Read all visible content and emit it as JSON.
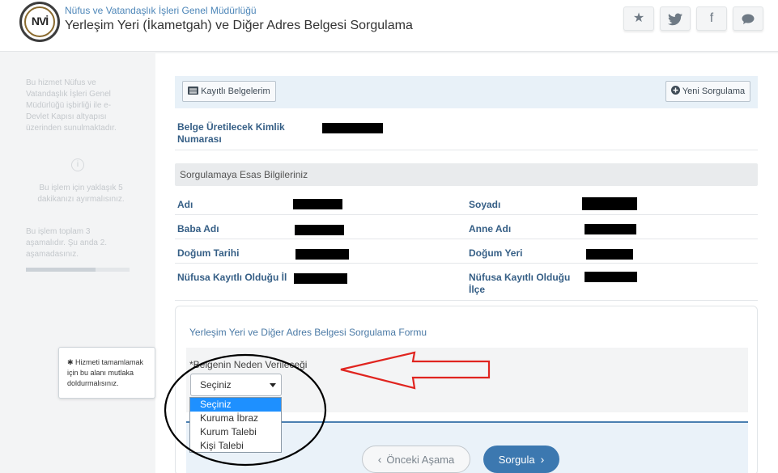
{
  "header": {
    "logo_text": "NVİ",
    "org_title": "Nüfus ve Vatandaşlık İşleri Genel Müdürlüğü",
    "page_title": "Yerleşim Yeri (İkametgah) ve Diğer Adres Belgesi Sorgulama",
    "buttons": [
      {
        "name": "favorite-button",
        "icon": "star-icon",
        "glyph": "★"
      },
      {
        "name": "twitter-button",
        "icon": "twitter-icon",
        "glyph": "🐦"
      },
      {
        "name": "facebook-button",
        "icon": "facebook-icon",
        "glyph": "f"
      },
      {
        "name": "comment-button",
        "icon": "comment-icon",
        "glyph": "💬"
      }
    ]
  },
  "sidebar": {
    "info_text": "Bu hizmet Nüfus ve Vatandaşlık İşleri Genel Müdürlüğü işbirliği ile e-Devlet Kapısı altyapısı üzerinden sunulmaktadır.",
    "duration_text": "Bu işlem için yaklaşık 5 dakikanızı ayırmalısınız.",
    "steps_text": "Bu işlem toplam 3 aşamalıdır. Şu anda 2. aşamadasınız.",
    "progress": 0.67
  },
  "topbar": {
    "saved_docs_label": "Kayıtlı Belgelerim",
    "new_query_label": "Yeni Sorgulama"
  },
  "identity": {
    "label": "Belge Üretilecek Kimlik Numarası"
  },
  "section_title": "Sorgulamaya Esas Bilgileriniz",
  "fields": {
    "ad": "Adı",
    "soyad": "Soyadı",
    "baba_adi": "Baba Adı",
    "anne_adi": "Anne Adı",
    "dogum_tarihi": "Doğum Tarihi",
    "dogum_yeri": "Doğum Yeri",
    "nufus_il": "Nüfusa Kayıtlı Olduğu İl",
    "nufus_ilce": "Nüfusa Kayıtlı Olduğu İlçe"
  },
  "form": {
    "title": "Yerleşim Yeri ve Diğer Adres Belgesi Sorgulama Formu",
    "field_label": "*Belgenin Neden Verileceği",
    "select_value": "Seçiniz",
    "options": [
      "Seçiniz",
      "Kuruma İbraz",
      "Kurum Talebi",
      "Kişi Talebi"
    ],
    "tooltip": "✱ Hizmeti tamamlamak için bu alanı mutlaka doldurmalısınız.",
    "prev_button": "Önceki Aşama",
    "submit_button": "Sorgula"
  },
  "colors": {
    "accent": "#3c78b0",
    "label_blue": "#365f86",
    "annotation_red": "#e0241f",
    "dropdown_selected": "#1e90ff"
  }
}
